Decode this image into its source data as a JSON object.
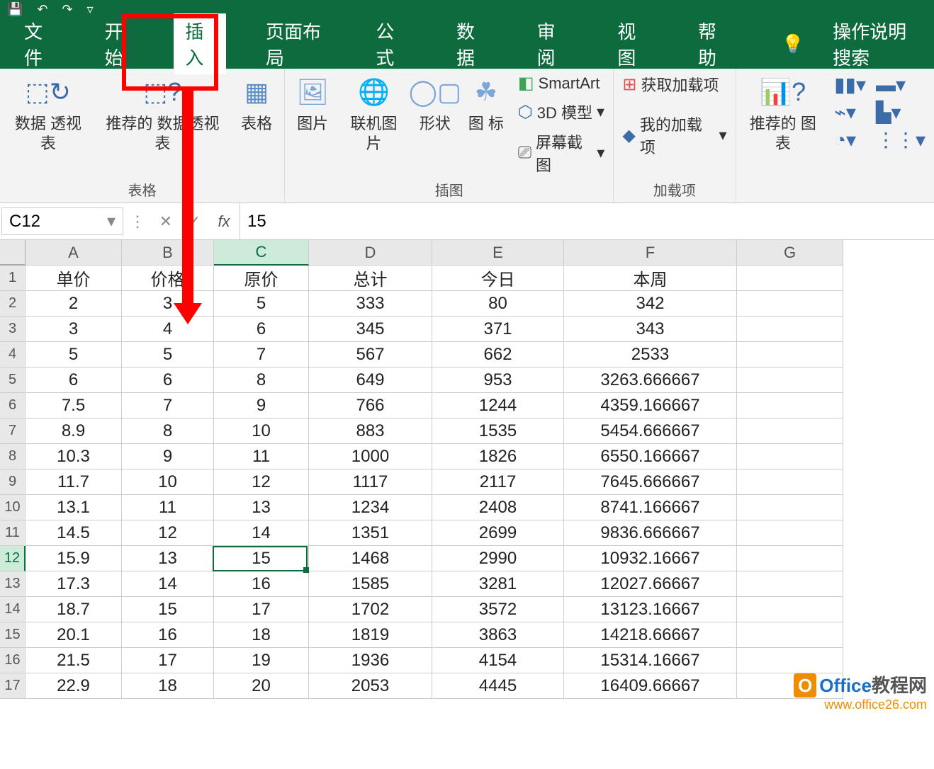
{
  "qat": {
    "save": "💾",
    "undo": "↶",
    "redo": "↷",
    "more": "▿"
  },
  "tabs": {
    "file": "文件",
    "home": "开始",
    "insert": "插入",
    "page_layout": "页面布局",
    "formulas": "公式",
    "data": "数据",
    "review": "审阅",
    "view": "视图",
    "help": "帮助",
    "search": "操作说明搜索"
  },
  "ribbon": {
    "groups": {
      "tables": {
        "label": "表格",
        "pivot": "数据\n透视表",
        "rec_pivot": "推荐的\n数据透视表",
        "table": "表格"
      },
      "illustrations": {
        "label": "插图",
        "pictures": "图片",
        "online_pictures": "联机图片",
        "shapes": "形状",
        "icons": "图\n标",
        "smartart": "SmartArt",
        "model3d": "3D 模型",
        "screenshot": "屏幕截图"
      },
      "addins": {
        "label": "加载项",
        "get": "获取加载项",
        "my": "我的加载项"
      },
      "charts": {
        "label": "推荐的\n图表"
      }
    }
  },
  "formula_bar": {
    "name_box": "C12",
    "formula": "15"
  },
  "columns": [
    "A",
    "B",
    "C",
    "D",
    "E",
    "F",
    "G"
  ],
  "row_numbers": [
    "1",
    "2",
    "3",
    "4",
    "5",
    "6",
    "7",
    "8",
    "9",
    "10",
    "11",
    "12",
    "13",
    "14",
    "15",
    "16",
    "17"
  ],
  "headers": [
    "单价",
    "价格",
    "原价",
    "总计",
    "今日",
    "本周",
    ""
  ],
  "rows": [
    [
      "2",
      "3",
      "5",
      "333",
      "80",
      "342",
      ""
    ],
    [
      "3",
      "4",
      "6",
      "345",
      "371",
      "343",
      ""
    ],
    [
      "5",
      "5",
      "7",
      "567",
      "662",
      "2533",
      ""
    ],
    [
      "6",
      "6",
      "8",
      "649",
      "953",
      "3263.666667",
      ""
    ],
    [
      "7.5",
      "7",
      "9",
      "766",
      "1244",
      "4359.166667",
      ""
    ],
    [
      "8.9",
      "8",
      "10",
      "883",
      "1535",
      "5454.666667",
      ""
    ],
    [
      "10.3",
      "9",
      "11",
      "1000",
      "1826",
      "6550.166667",
      ""
    ],
    [
      "11.7",
      "10",
      "12",
      "1117",
      "2117",
      "7645.666667",
      ""
    ],
    [
      "13.1",
      "11",
      "13",
      "1234",
      "2408",
      "8741.166667",
      ""
    ],
    [
      "14.5",
      "12",
      "14",
      "1351",
      "2699",
      "9836.666667",
      ""
    ],
    [
      "15.9",
      "13",
      "15",
      "1468",
      "2990",
      "10932.16667",
      ""
    ],
    [
      "17.3",
      "14",
      "16",
      "1585",
      "3281",
      "12027.66667",
      ""
    ],
    [
      "18.7",
      "15",
      "17",
      "1702",
      "3572",
      "13123.16667",
      ""
    ],
    [
      "20.1",
      "16",
      "18",
      "1819",
      "3863",
      "14218.66667",
      ""
    ],
    [
      "21.5",
      "17",
      "19",
      "1936",
      "4154",
      "15314.16667",
      ""
    ],
    [
      "22.9",
      "18",
      "20",
      "2053",
      "4445",
      "16409.66667",
      ""
    ]
  ],
  "selected": {
    "row_index": 11,
    "col_index": 2
  },
  "watermark": {
    "brand1": "Office",
    "brand2": "教程网",
    "url": "www.office26.com"
  }
}
